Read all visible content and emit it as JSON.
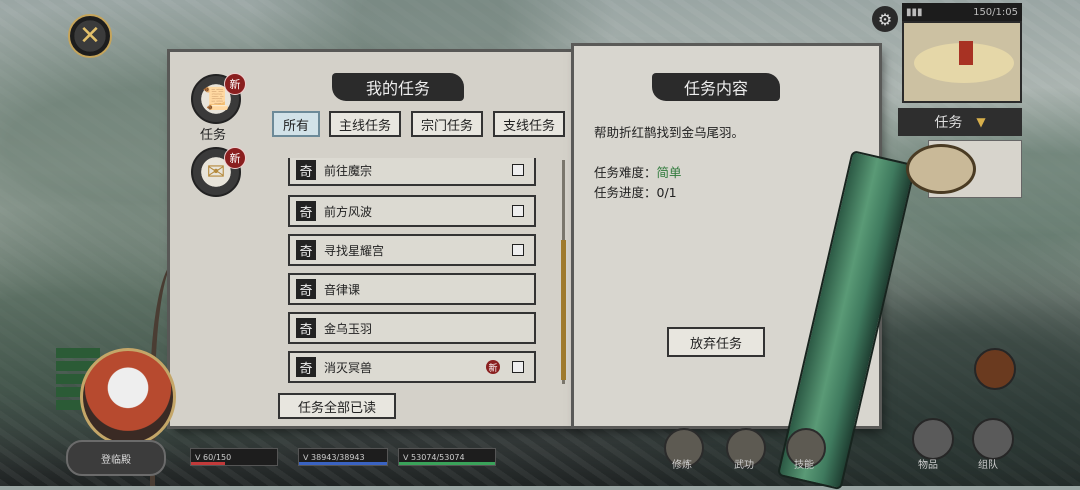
{
  "top": {
    "status_text": "150/1:05"
  },
  "map_panel": {
    "tab_label": "任务"
  },
  "side": {
    "quest_tab_label": "任务",
    "new_badge": "新"
  },
  "left_panel": {
    "title": "我的任务",
    "tabs": [
      "所有",
      "主线任务",
      "宗门任务",
      "支线任务"
    ],
    "active_tab": "所有",
    "quests": [
      {
        "icon": "奇",
        "label": "前往魔宗",
        "checkbox": true,
        "new": false
      },
      {
        "icon": "奇",
        "label": "前方风波",
        "checkbox": true,
        "new": false
      },
      {
        "icon": "奇",
        "label": "寻找星耀宫",
        "checkbox": true,
        "new": false
      },
      {
        "icon": "奇",
        "label": "音律课",
        "checkbox": false,
        "new": false
      },
      {
        "icon": "奇",
        "label": "金乌玉羽",
        "checkbox": false,
        "new": false
      },
      {
        "icon": "奇",
        "label": "消灭冥兽",
        "checkbox": true,
        "new": true
      }
    ],
    "mark_all_read": "任务全部已读",
    "row_new_badge": "新"
  },
  "right_panel": {
    "title": "任务内容",
    "description": "帮助折红鹊找到金乌尾羽。",
    "difficulty_label": "任务难度：",
    "difficulty_value": "简单",
    "progress_label": "任务进度：",
    "progress_value": "0/1",
    "abandon_button": "放弃任务"
  },
  "bottom": {
    "player_button": "登临殿",
    "stats": [
      {
        "text": "ᐯ 60/150",
        "color": "#c23a3a"
      },
      {
        "text": "ᐯ 38943/38943",
        "color": "#3a63c2"
      },
      {
        "text": "ᐯ 53074/53074",
        "color": "#3aa35a"
      }
    ],
    "nav": [
      "修炼",
      "武功",
      "技能",
      "物品",
      "组队"
    ]
  },
  "colors": {
    "accent_gold": "#c5a45a",
    "easy_green": "#2f7a3b",
    "new_red": "#8a1f1f"
  }
}
